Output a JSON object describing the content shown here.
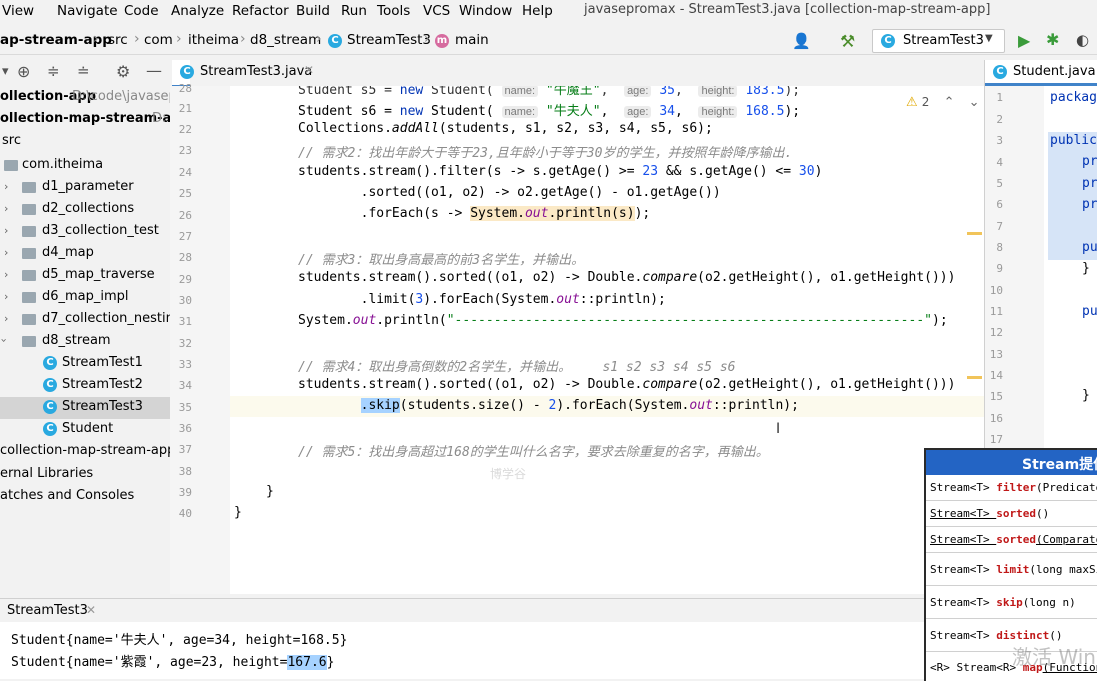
{
  "menu": [
    "View",
    "Navigate",
    "Code",
    "Analyze",
    "Refactor",
    "Build",
    "Run",
    "Tools",
    "VCS",
    "Window",
    "Help"
  ],
  "window_title": "javasepromax - StreamTest3.java [collection-map-stream-app]",
  "breadcrumbs": [
    "ap-stream-app",
    "src",
    "com",
    "itheima",
    "d8_stream",
    "StreamTest3",
    "main"
  ],
  "run_config": "StreamTest3",
  "project_tree": [
    {
      "label": "ollection-app",
      "extra": "D:\\code\\javasep",
      "bold": true
    },
    {
      "label": "ollection-map-stream-app",
      "extra": "D:",
      "bold": true
    },
    {
      "label": "src"
    },
    {
      "label": "com.itheima"
    },
    {
      "label": "d1_parameter"
    },
    {
      "label": "d2_collections"
    },
    {
      "label": "d3_collection_test"
    },
    {
      "label": "d4_map"
    },
    {
      "label": "d5_map_traverse"
    },
    {
      "label": "d6_map_impl"
    },
    {
      "label": "d7_collection_nesting"
    },
    {
      "label": "d8_stream"
    },
    {
      "label": "StreamTest1"
    },
    {
      "label": "StreamTest2"
    },
    {
      "label": "StreamTest3"
    },
    {
      "label": "Student"
    },
    {
      "label": "collection-map-stream-app.i"
    },
    {
      "label": "ernal Libraries"
    },
    {
      "label": "atches and Consoles"
    }
  ],
  "editor": {
    "tab": "StreamTest3.java",
    "warnings": "2",
    "line_numbers": [
      "28",
      "21",
      "22",
      "23",
      "24",
      "25",
      "26",
      "27",
      "28",
      "29",
      "30",
      "31",
      "32",
      "33",
      "34",
      "35",
      "36",
      "37",
      "38",
      "39",
      "40"
    ],
    "hints": {
      "name": "name:",
      "age": "age:",
      "height": "height:"
    },
    "lines": {
      "l20_a": "Student s6 = ",
      "l20_new": "new",
      "l20_b": " Student( ",
      "l20_str": "\"牛夫人\"",
      "l20_c": ",  ",
      "l20_num1": "34",
      "l20_d": ",  ",
      "l20_num2": "168.5",
      "l20_e": ");",
      "l21_a": "Collections.",
      "l21_m": "addAll",
      "l21_b": "(students, s1, s2, s3, s4, s5, s6);",
      "l22": "// 需求2：找出年龄大于等于23,且年龄小于等于30岁的学生，并按照年龄降序输出.",
      "l23_a": "students.stream().filter(s -> s.getAge() >= ",
      "l23_n1": "23",
      "l23_b": " && s.getAge() <= ",
      "l23_n2": "30",
      "l23_c": ")",
      "l24": "        .sorted((o1, o2) -> o2.getAge() - o1.getAge())",
      "l25_a": "        .forEach(s -> ",
      "l25_hl_a": "System.",
      "l25_hl_f": "out",
      "l25_hl_b": ".println(s)",
      "l25_b": ");",
      "l27": "// 需求3：取出身高最高的前3名学生，并输出。",
      "l28_a": "students.stream().sorted((o1, o2) -> Double.",
      "l28_m": "compare",
      "l28_b": "(o2.getHeight(), o1.getHeight()))",
      "l29_a": "        .limit(",
      "l29_n": "3",
      "l29_b": ").forEach(System.",
      "l29_f": "out",
      "l29_c": "::println);",
      "l30_a": "System.",
      "l30_f": "out",
      "l30_b": ".println(",
      "l30_s": "\"------------------------------------------------------------\"",
      "l30_c": ");",
      "l32": "// 需求4：取出身高倒数的2名学生，并输出。    s1 s2 s3 s4 s5 s6",
      "l33_a": "students.stream().sorted((o1, o2) -> Double.",
      "l33_m": "compare",
      "l33_b": "(o2.getHeight(), o1.getHeight()))",
      "l34_sel": ".skip",
      "l34_a": "(students.size() - ",
      "l34_n": "2",
      "l34_b": ").forEach(System.",
      "l34_f": "out",
      "l34_c": "::println);",
      "l36": "// 需求5：找出身高超过168的学生叫什么名字，要求去除重复的名字，再输出。",
      "l38": "}",
      "l39": "}"
    },
    "watermark": "博学谷"
  },
  "right_editor": {
    "tab": "Student.java",
    "line_numbers": [
      "1",
      "2",
      "3",
      "4",
      "5",
      "6",
      "7",
      "8",
      "9",
      "10",
      "11",
      "12",
      "13",
      "14",
      "15",
      "16",
      "17"
    ],
    "snippets": [
      "packag",
      "public",
      "pr",
      "pr",
      "pr",
      "pu",
      "}",
      "pu",
      "}"
    ]
  },
  "run_panel": {
    "tab": "StreamTest3",
    "line1": "Student{name='牛夫人', age=34, height=168.5}",
    "line2_a": "Student{name='紫霞', age=23, height=",
    "line2_sel": "167.6",
    "line2_b": "}"
  },
  "popup": {
    "title": "Stream提供",
    "rows": [
      {
        "ret": "Stream<T> ",
        "method": "filter",
        "args": "(Predicate"
      },
      {
        "ret": "Stream<T> ",
        "method": "sorted",
        "args": "()"
      },
      {
        "ret": "Stream<T> ",
        "method": "sorted",
        "args": "(Comparato"
      },
      {
        "ret": "Stream<T> ",
        "method": "limit",
        "args": "(long maxSi"
      },
      {
        "ret": "Stream<T> ",
        "method": "skip",
        "args": "(long n)"
      },
      {
        "ret": "Stream<T> ",
        "method": "distinct",
        "args": "()"
      },
      {
        "ret": "<R> Stream<R> ",
        "method": "map",
        "args": "(Function"
      }
    ]
  },
  "os_watermark": "激活 Win"
}
